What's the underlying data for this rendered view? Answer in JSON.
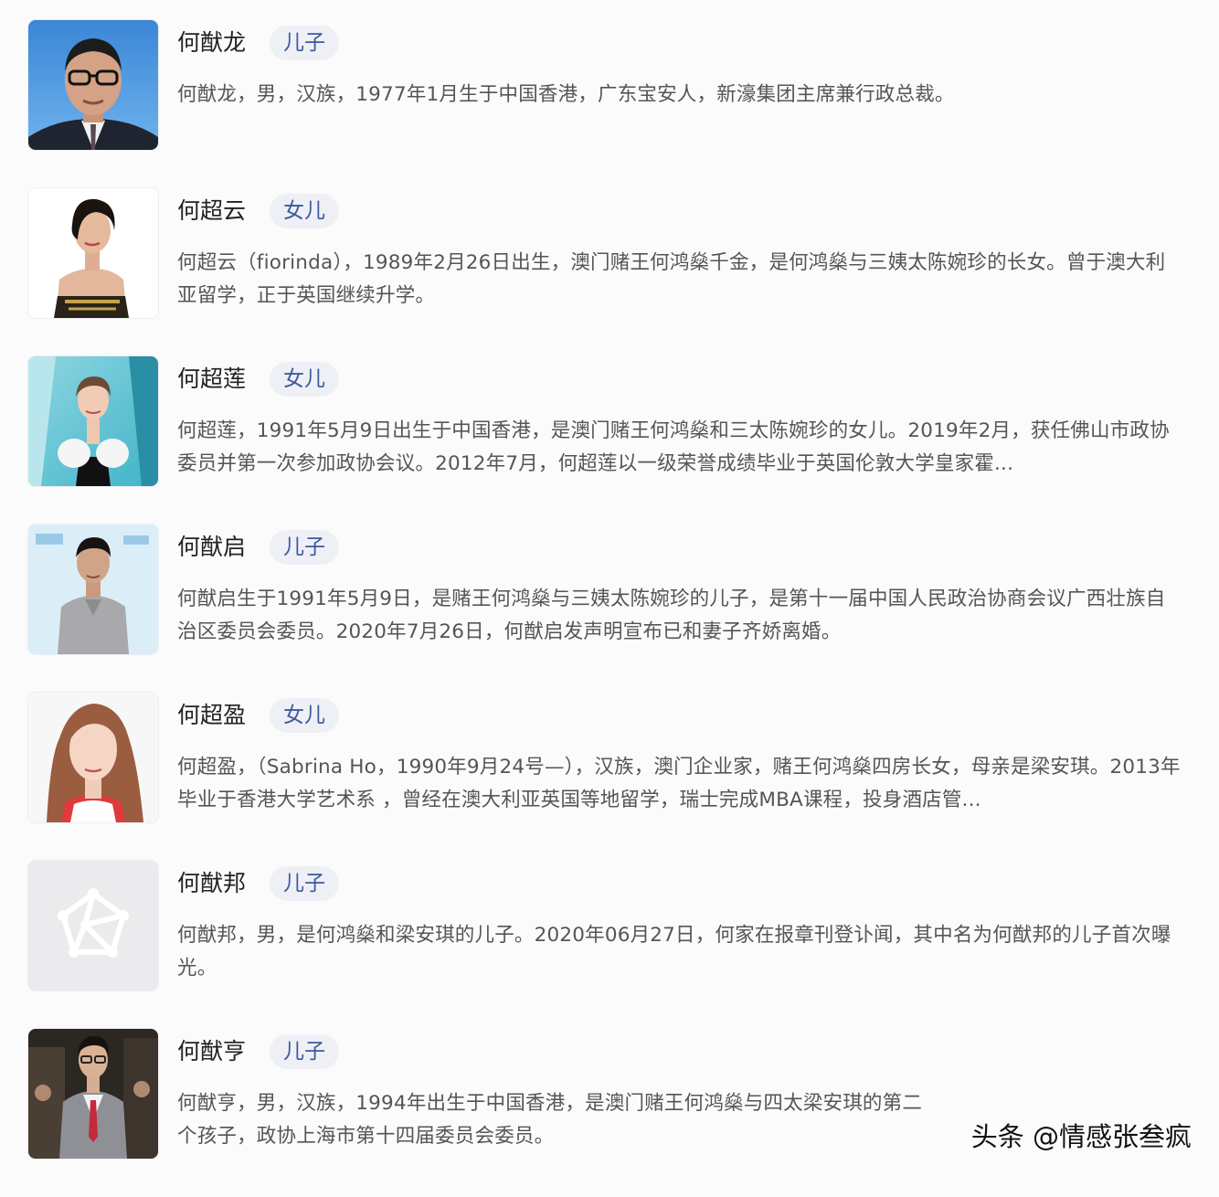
{
  "people": [
    {
      "name": "何猷龙",
      "relation": "儿子",
      "description": "何猷龙，男，汉族，1977年1月生于中国香港，广东宝安人，新濠集团主席兼行政总裁。"
    },
    {
      "name": "何超云",
      "relation": "女儿",
      "description": "何超云（fiorinda），1989年2月26日出生，澳门赌王何鸿燊千金，是何鸿燊与三姨太陈婉珍的长女。曾于澳大利亚留学，正于英国继续升学。"
    },
    {
      "name": "何超莲",
      "relation": "女儿",
      "description": "何超莲，1991年5月9日出生于中国香港，是澳门赌王何鸿燊和三太陈婉珍的女儿。2019年2月，获任佛山市政协委员并第一次参加政协会议。2012年7月，何超莲以一级荣誉成绩毕业于英国伦敦大学皇家霍..."
    },
    {
      "name": "何猷启",
      "relation": "儿子",
      "description": "何猷启生于1991年5月9日，是赌王何鸿燊与三姨太陈婉珍的儿子，是第十一届中国人民政治协商会议广西壮族自治区委员会委员。2020年7月26日，何猷启发声明宣布已和妻子齐娇离婚。"
    },
    {
      "name": "何超盈",
      "relation": "女儿",
      "description": "何超盈，（Sabrina Ho，1990年9月24号—），汉族，澳门企业家，赌王何鸿燊四房长女，母亲是梁安琪。2013年毕业于香港大学艺术系 ，曾经在澳大利亚英国等地留学，瑞士完成MBA课程，投身酒店管..."
    },
    {
      "name": "何猷邦",
      "relation": "儿子",
      "description": "何猷邦，男，是何鸿燊和梁安琪的儿子。2020年06月27日，何家在报章刊登讣闻，其中名为何猷邦的儿子首次曝光。"
    },
    {
      "name": "何猷亨",
      "relation": "儿子",
      "description": "何猷亨，男，汉族，1994年出生于中国香港，是澳门赌王何鸿燊与四太梁安琪的第二个孩子，政协上海市第十四届委员会委员。"
    }
  ],
  "watermark": "头条 @情感张叁疯",
  "icons": {
    "placeholder": "pentagon-placeholder-icon"
  }
}
